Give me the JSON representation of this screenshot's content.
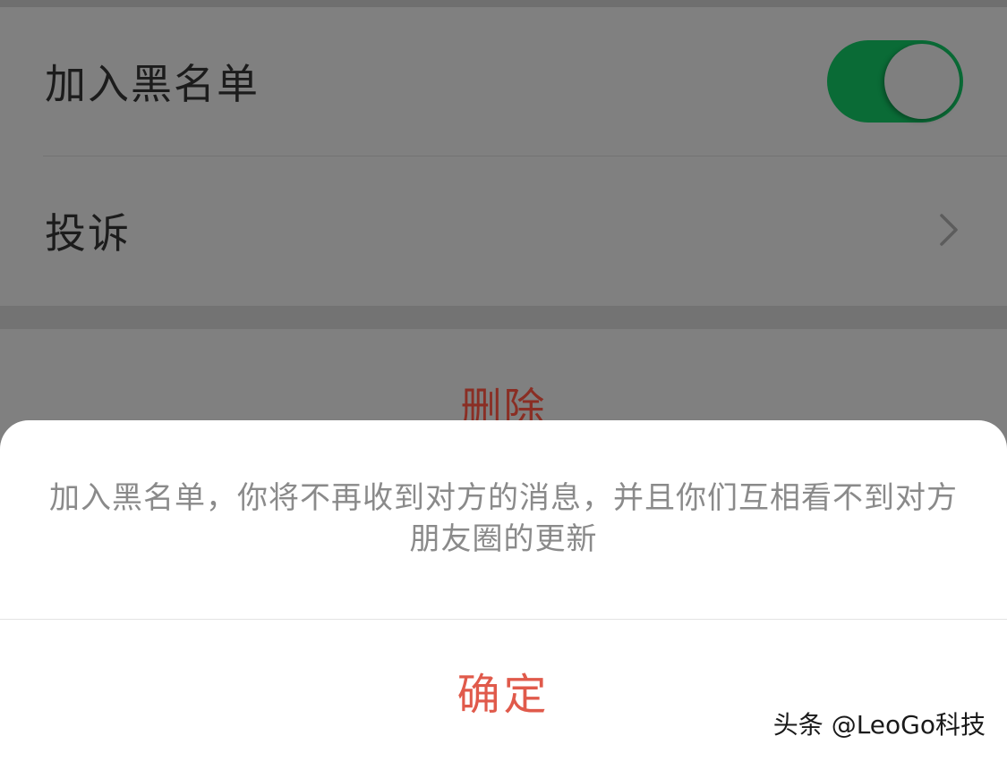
{
  "settings": {
    "blacklist": {
      "label": "加入黑名单",
      "toggle_on": true,
      "toggle_color": "#0a6b36"
    },
    "complain": {
      "label": "投诉",
      "icon": "chevron-right-icon"
    }
  },
  "delete": {
    "label": "删除",
    "color": "#8a2e24"
  },
  "dialog": {
    "message": "加入黑名单，你将不再收到对方的消息，并且你们互相看不到对方朋友圈的更新",
    "confirm_label": "确定",
    "confirm_color": "#e05a4b"
  },
  "watermark": {
    "text": "头条 @LeoGo科技"
  }
}
